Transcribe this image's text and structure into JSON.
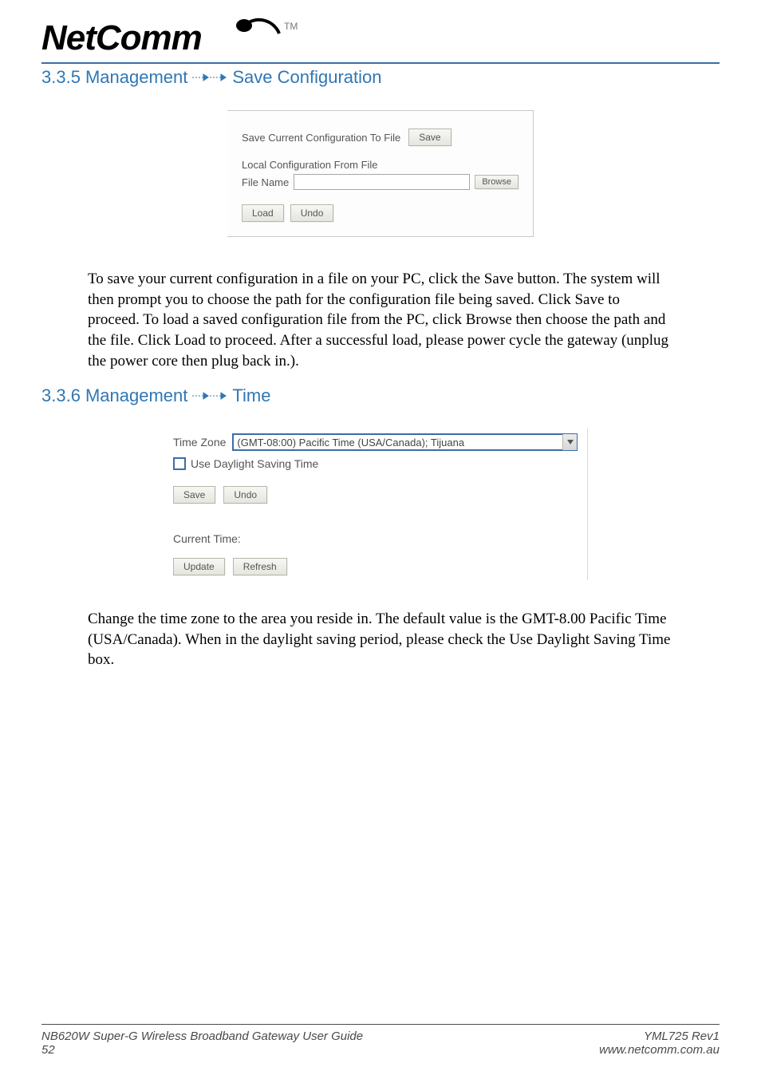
{
  "header": {
    "logo_text": "NetComm",
    "tm": "TM"
  },
  "section1": {
    "number": "3.3.5",
    "title_left": "Management",
    "title_right": "Save Configuration"
  },
  "panel1": {
    "save_label": "Save Current Configuration To File",
    "save_btn": "Save",
    "local_label": "Local Configuration From File",
    "file_label": "File Name",
    "file_value": "",
    "browse_btn": "Browse",
    "load_btn": "Load",
    "undo_btn": "Undo"
  },
  "para1": "To save your current configuration in a file on your PC, click the Save button. The system will then prompt you to choose the path for the configuration file being saved.  Click Save to proceed. To load a saved configuration file from the PC, click Browse then choose the path and the file.  Click Load to proceed. After a successful load, please power cycle the gateway (unplug the power core then plug back in.).",
  "section2": {
    "number": "3.3.6",
    "title_left": "Management",
    "title_right": "Time"
  },
  "time_panel": {
    "tz_label": "Time Zone",
    "tz_value": "(GMT-08:00) Pacific Time (USA/Canada); Tijuana",
    "dst_label": "Use Daylight Saving Time",
    "save_btn": "Save",
    "undo_btn": "Undo",
    "current_label": "Current Time:",
    "update_btn": "Update",
    "refresh_btn": "Refresh"
  },
  "para2": "Change the time zone to the area you reside in. The default value is the GMT-8.00 Pacific Time (USA/Canada). When in the daylight saving period, please check the Use Daylight Saving Time box.",
  "footer": {
    "guide": "NB620W Super-G Wireless Broadband  Gateway User Guide",
    "page": "52",
    "rev": "YML725 Rev1",
    "url": "www.netcomm.com.au"
  }
}
